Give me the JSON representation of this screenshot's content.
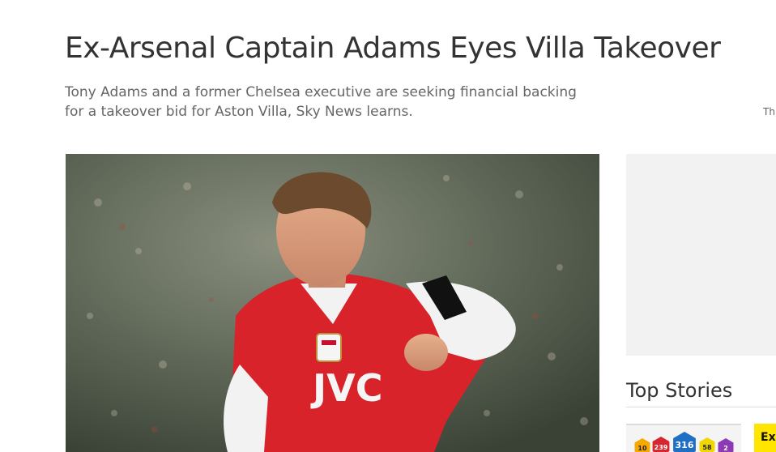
{
  "article": {
    "headline": "Ex-Arsenal Captain Adams Eyes Villa Takeover",
    "standfirst_line1": "Tony Adams and a former Chelsea executive are seeking financial backing",
    "standfirst_line2": "for a takeover bid for Aston Villa, Sky News learns.",
    "hero_image": {
      "shirt_sponsor": "JVC"
    }
  },
  "sidebar": {
    "teaser_snippet": "Th",
    "top_stories_title": "Top Stories",
    "stories": [
      {
        "badges": [
          "10",
          "239",
          "316",
          "58",
          "2"
        ],
        "badge_colors": [
          "#f6a800",
          "#d7262e",
          "#1f6fc5",
          "#f2d600",
          "#8e3ab6"
        ]
      },
      {
        "title_snippet": "Ex"
      }
    ]
  },
  "colors": {
    "headline": "#333333",
    "standfirst": "#666666",
    "ad_background": "#f2f2f2",
    "story_accent": "#ffe500"
  }
}
